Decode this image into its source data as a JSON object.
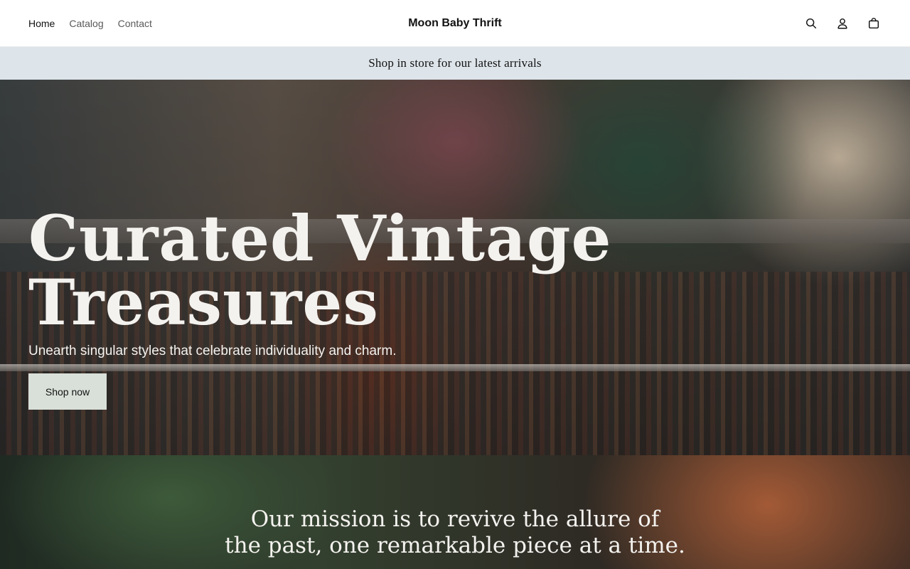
{
  "header": {
    "nav": [
      {
        "label": "Home",
        "active": true
      },
      {
        "label": "Catalog",
        "active": false
      },
      {
        "label": "Contact",
        "active": false
      }
    ],
    "brand": "Moon Baby Thrift",
    "icons": [
      "search-icon",
      "account-icon",
      "cart-icon"
    ]
  },
  "announcement": {
    "text": "Shop in store for our latest arrivals"
  },
  "hero": {
    "title_line1": "Curated Vintage",
    "title_line2": "Treasures",
    "subtitle": "Unearth singular styles that celebrate individuality and charm.",
    "button_label": "Shop now"
  },
  "mission": {
    "line1": "Our mission is to revive the allure of",
    "line2": "the past, one remarkable piece at a time."
  },
  "colors": {
    "announcement_bg": "#dde4ea",
    "button_bg": "#d9e0d9",
    "text_light": "#f4f2ef",
    "text_dark": "#121212"
  }
}
